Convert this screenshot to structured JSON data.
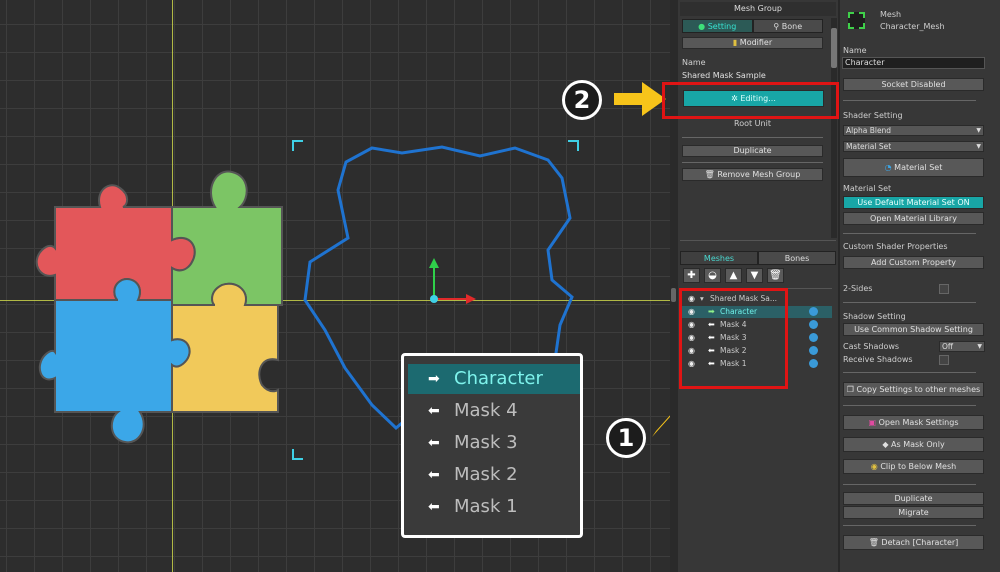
{
  "mid_panel": {
    "title": "Mesh Group",
    "tabs": [
      {
        "label": "Setting",
        "active": true
      },
      {
        "label": "Bone",
        "active": false
      }
    ],
    "modifier_button": "Modifier",
    "name_label": "Name",
    "name_value": "Shared Mask Sample",
    "editing_button": "Editing...",
    "root_unit": "Root Unit",
    "duplicate_button": "Duplicate",
    "remove_button": "Remove Mesh Group"
  },
  "hierarchy": {
    "tabs": [
      {
        "label": "Meshes",
        "active": true
      },
      {
        "label": "Bones",
        "active": false
      }
    ],
    "root": "Shared Mask Sa...",
    "items": [
      {
        "label": "Character",
        "selected": true
      },
      {
        "label": "Mask 4",
        "selected": false
      },
      {
        "label": "Mask 3",
        "selected": false
      },
      {
        "label": "Mask 2",
        "selected": false
      },
      {
        "label": "Mask 1",
        "selected": false
      }
    ]
  },
  "popup": {
    "items": [
      {
        "label": "Character",
        "selected": true
      },
      {
        "label": "Mask 4",
        "selected": false
      },
      {
        "label": "Mask 3",
        "selected": false
      },
      {
        "label": "Mask 2",
        "selected": false
      },
      {
        "label": "Mask 1",
        "selected": false
      }
    ]
  },
  "badges": {
    "one": "1",
    "two": "2"
  },
  "right_panel": {
    "header_type": "Mesh",
    "header_name": "Character_Mesh",
    "name_label": "Name",
    "name_value": "Character",
    "socket_button": "Socket Disabled",
    "shader_label": "Shader Setting",
    "shader_value": "Alpha Blend",
    "material_dropdown": "Material Set",
    "material_set_button": "Material Set",
    "material_set_label": "Material Set",
    "use_default_button": "Use Default Material Set ON",
    "open_library_button": "Open Material Library",
    "custom_shader_label": "Custom Shader Properties",
    "add_custom_button": "Add Custom Property",
    "two_sides_label": "2-Sides",
    "shadow_label": "Shadow Setting",
    "common_shadow_button": "Use Common Shadow Setting",
    "cast_shadows_label": "Cast Shadows",
    "cast_shadows_value": "Off",
    "receive_shadows_label": "Receive Shadows",
    "copy_settings_button": "Copy Settings to other meshes",
    "open_mask_button": "Open Mask Settings",
    "as_mask_button": "As Mask Only",
    "clip_button": "Clip to Below Mesh",
    "duplicate_button": "Duplicate",
    "migrate_button": "Migrate",
    "detach_button": "Detach [Character]"
  },
  "colors": {
    "accent_teal": "#18a6a6",
    "highlight_red": "#e01414",
    "arrow_yellow": "#f7c41a"
  }
}
